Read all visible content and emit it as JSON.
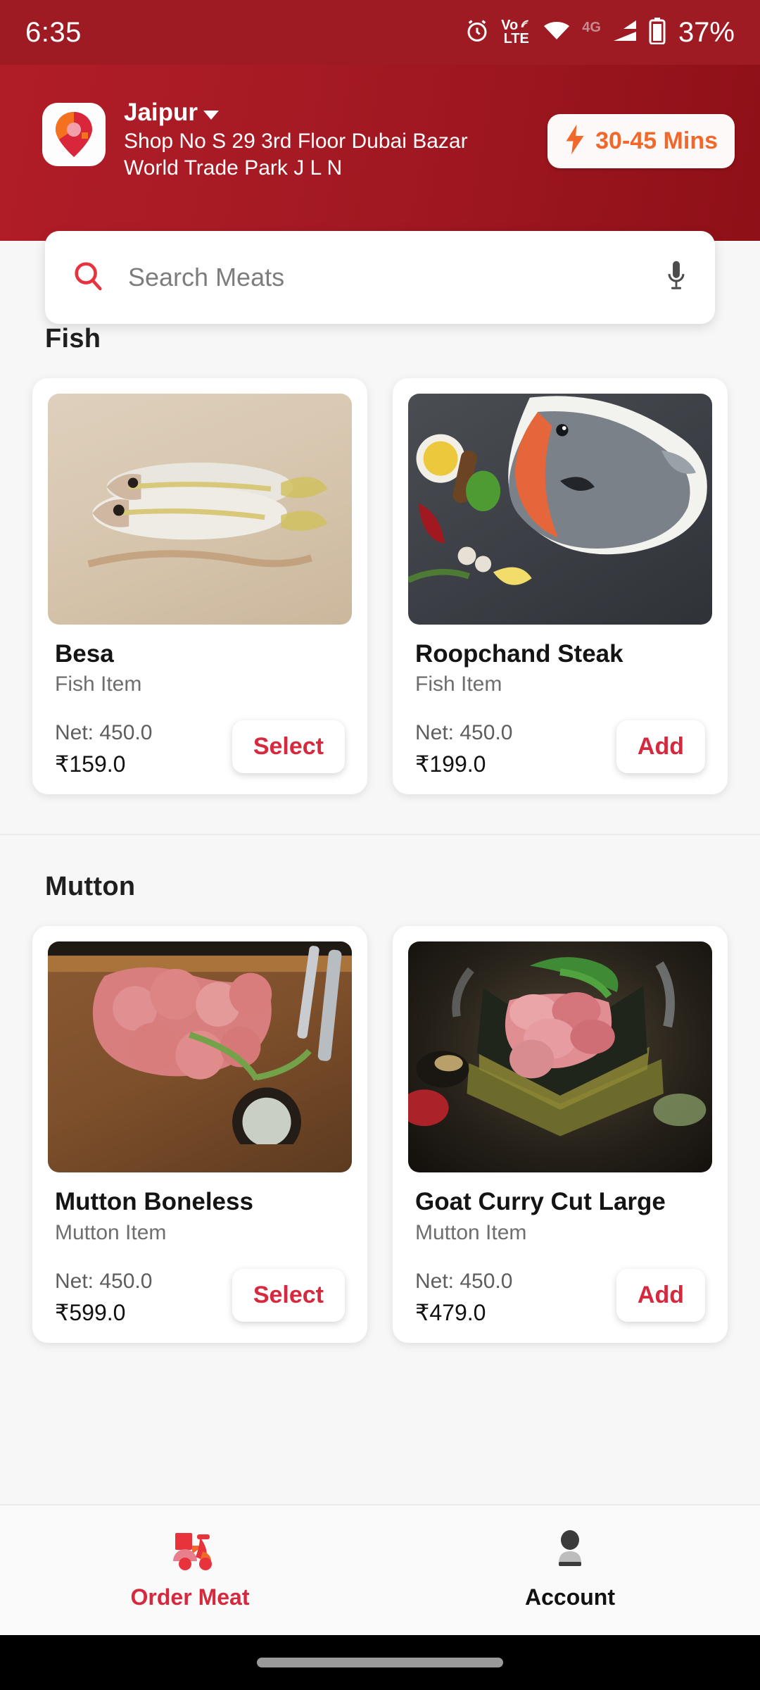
{
  "statusbar": {
    "time": "6:35",
    "battery": "37%",
    "network_type": "4G",
    "volte_top": "Vo",
    "volte_bottom": "LTE",
    "icons": [
      "alarm-icon",
      "volte-icon",
      "wifi-icon",
      "signal-icon",
      "battery-icon"
    ]
  },
  "header": {
    "logo": "app-logo-map-pin",
    "city": "Jaipur",
    "address": "Shop No S 29 3rd Floor Dubai Bazar World Trade Park J L N",
    "eta_badge": {
      "icon": "lightning-bolt-icon",
      "label": "30-45 Mins"
    }
  },
  "search": {
    "placeholder": "Search Meats",
    "search_icon": "search-icon",
    "mic_icon": "microphone-icon"
  },
  "sections": [
    {
      "title": "Fish",
      "products": [
        {
          "name": "Besa",
          "category": "Fish Item",
          "net": "Net: 450.0",
          "price": "₹159.0",
          "action": "Select",
          "image": "whole-fish-on-wooden-board-photo"
        },
        {
          "name": "Roopchand  Steak",
          "category": "Fish Item",
          "net": "Net: 450.0",
          "price": "₹199.0",
          "action": "Add",
          "image": "pomfret-fish-on-white-plate-photo"
        }
      ]
    },
    {
      "title": "Mutton",
      "products": [
        {
          "name": "Mutton Boneless",
          "category": "Mutton Item",
          "net": "Net: 450.0",
          "price": "₹599.0",
          "action": "Select",
          "image": "raw-mutton-cubes-on-cutting-board-photo"
        },
        {
          "name": "Goat Curry Cut Large",
          "category": "Mutton Item",
          "net": "Net: 450.0",
          "price": "₹479.0",
          "action": "Add",
          "image": "goat-curry-cut-on-dark-plate-photo"
        }
      ]
    }
  ],
  "bottom_nav": {
    "items": [
      {
        "label": "Order Meat",
        "icon": "delivery-scooter-icon",
        "active": true
      },
      {
        "label": "Account",
        "icon": "person-icon",
        "active": false
      }
    ]
  },
  "colors": {
    "brand_red": "#9e1b23",
    "header_red": "#b11d27",
    "accent_red": "#d6293e",
    "accent_orange": "#f2682a",
    "page_bg": "#f7f7f7"
  }
}
